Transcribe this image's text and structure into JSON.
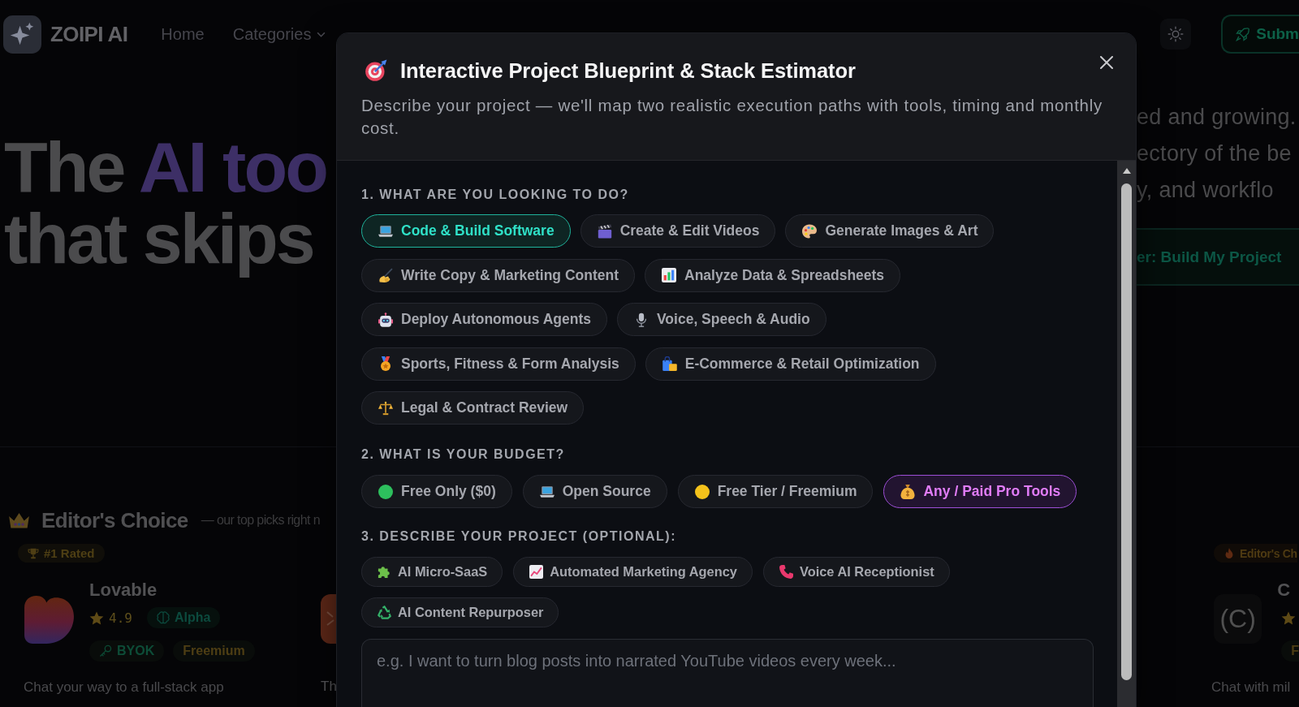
{
  "nav": {
    "brand": "ZOIPI AI",
    "items": [
      {
        "label": "Home",
        "kind": "link"
      },
      {
        "label": "Categories",
        "kind": "dropdown"
      }
    ],
    "submit_button": "Subm"
  },
  "hero": {
    "heading": [
      [
        {
          "text": "The",
          "accent": false
        },
        {
          "text": "AI too",
          "accent": true
        }
      ],
      [
        {
          "text": "that skips",
          "accent": false
        }
      ]
    ],
    "tagline_lines": [
      "ed and growing.",
      "ectory of the be",
      "y, and workflo"
    ],
    "cta_button": "er: Build My Project"
  },
  "editors_choice": {
    "title": "Editor's Choice",
    "subtitle": "— our top picks right n",
    "first_card": {
      "badge": "#1 Rated",
      "name": "Lovable",
      "rating": "4.9",
      "model": "Alpha",
      "tags": [
        {
          "label": "BYOK",
          "color": "#0d4c37"
        },
        {
          "label": "Freemium",
          "color": "#4e3e14"
        }
      ],
      "description": "Chat your way to a full-stack app"
    },
    "second_card": {
      "description": "Th"
    },
    "last_card": {
      "badge": "Editor's Ch",
      "logo_text": "(C)",
      "name": "C",
      "tags": [
        {
          "label": "F",
          "color": "#4e3e14"
        }
      ],
      "description": "Chat with mil"
    }
  },
  "modal": {
    "title": "Interactive Project Blueprint & Stack Estimator",
    "subtitle": "Describe your project — we'll map two realistic execution paths with tools, timing and monthly cost.",
    "sections": [
      {
        "label": "1. WHAT ARE YOU LOOKING TO DO?",
        "kind": "choices",
        "options": [
          {
            "label": "Code & Build Software",
            "selected": true
          },
          {
            "label": "Create & Edit Videos",
            "selected": false
          },
          {
            "label": "Generate Images & Art",
            "selected": false
          },
          {
            "label": "Write Copy & Marketing Content",
            "selected": false
          },
          {
            "label": "Analyze Data & Spreadsheets",
            "selected": false
          },
          {
            "label": "Deploy Autonomous Agents",
            "selected": false
          },
          {
            "label": "Voice, Speech & Audio",
            "selected": false
          },
          {
            "label": "Sports, Fitness & Form Analysis",
            "selected": false
          },
          {
            "label": "E-Commerce & Retail Optimization",
            "selected": false
          },
          {
            "label": "Legal & Contract Review",
            "selected": false
          }
        ]
      },
      {
        "label": "2. WHAT IS YOUR BUDGET?",
        "kind": "choices",
        "options": [
          {
            "label": "Free Only ($0)",
            "selected": false
          },
          {
            "label": "Open Source",
            "selected": false
          },
          {
            "label": "Free Tier / Freemium",
            "selected": false
          },
          {
            "label": "Any / Paid Pro Tools",
            "selected": true
          }
        ]
      },
      {
        "label": "3. DESCRIBE YOUR PROJECT (OPTIONAL):",
        "kind": "examples",
        "options": [
          {
            "label": "AI Micro-SaaS"
          },
          {
            "label": "Automated Marketing Agency"
          },
          {
            "label": "Voice AI Receptionist"
          },
          {
            "label": "AI Content Repurposer"
          }
        ],
        "placeholder": "e.g. I want to turn blog posts into narrated YouTube videos every week..."
      }
    ]
  }
}
